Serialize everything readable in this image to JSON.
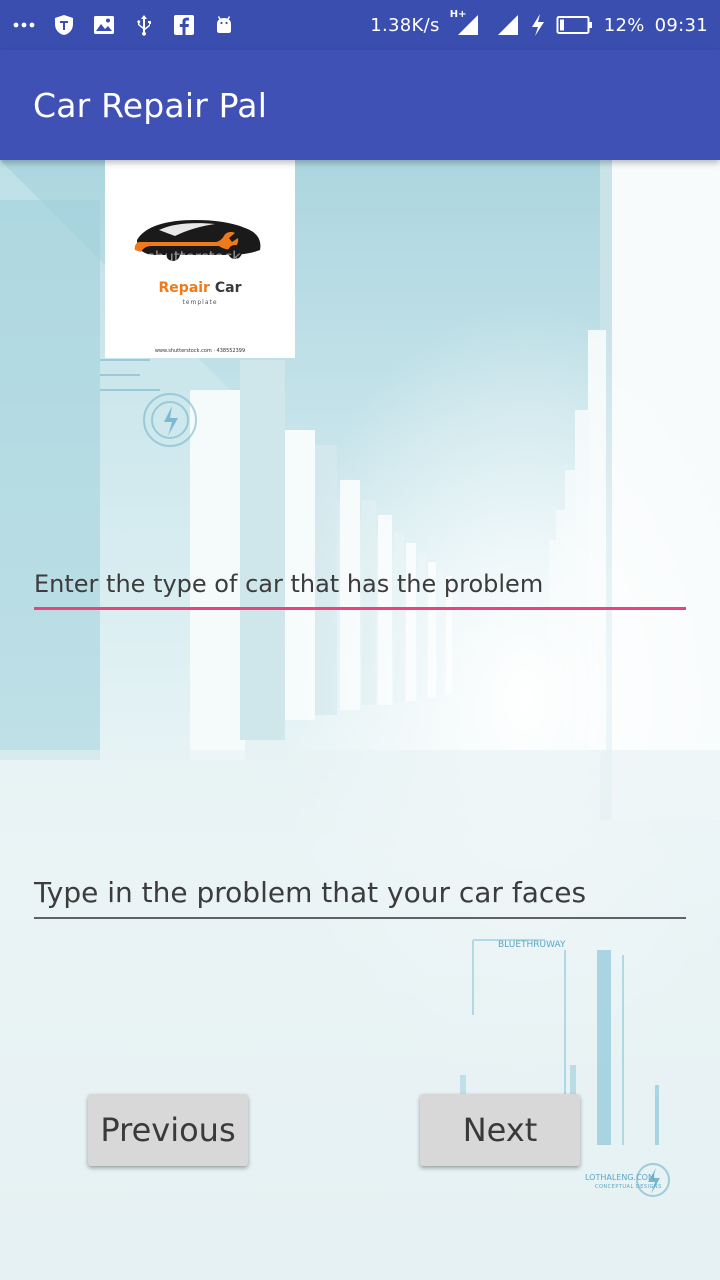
{
  "status_bar": {
    "network_speed": "1.38K/s",
    "network_type": "H+",
    "battery_percent": "12%",
    "time": "09:31",
    "left_icons": [
      "more-dots-icon",
      "vpn-shield-icon",
      "image-icon",
      "usb-icon",
      "facebook-icon",
      "android-icon"
    ],
    "right_icons": [
      "signal-strength-icon",
      "signal-strength-icon",
      "charging-bolt-icon",
      "battery-icon"
    ]
  },
  "app_bar": {
    "title": "Car Repair Pal"
  },
  "logo": {
    "brand_first": "Repair",
    "brand_second": "Car",
    "subtitle": "template",
    "watermark": "shutterstock",
    "footer": "www.shutterstock.com · 438552399"
  },
  "form": {
    "car_type_placeholder": "Enter the type of car that has the problem",
    "problem_placeholder": "Type in the problem that your car faces"
  },
  "buttons": {
    "previous": "Previous",
    "next": "Next"
  },
  "background_watermarks": {
    "blue_label": "BLUETHRUWAY",
    "site": "LOTHALENG.COM",
    "site_sub": "CONCEPTUAL DESIGNS"
  },
  "colors": {
    "status_bar": "#3a4eb0",
    "app_bar": "#3f51b5",
    "focus_underline": "#e8457f",
    "idle_underline": "#5d6266",
    "button_bg": "#d8d8d8",
    "logo_orange": "#ee7a1a"
  }
}
